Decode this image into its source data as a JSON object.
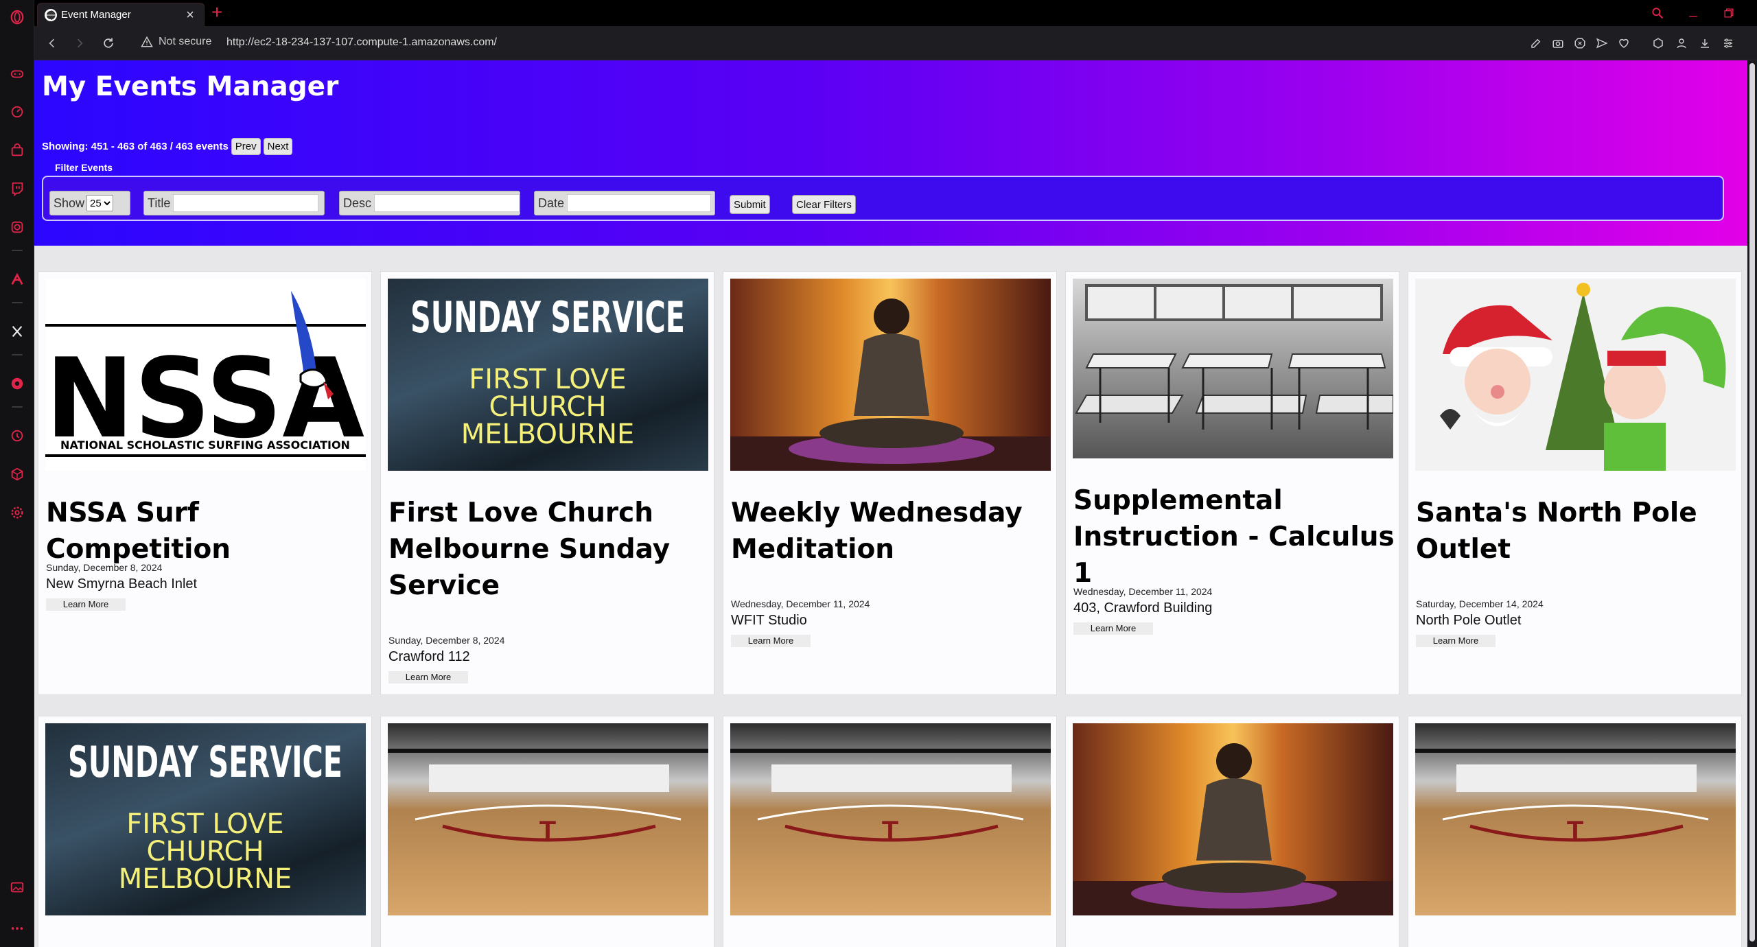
{
  "browser": {
    "tab_title": "Event Manager",
    "new_tab": "+",
    "tab_close": "×",
    "security_label": "Not secure",
    "url": "http://ec2-18-234-137-107.compute-1.amazonaws.com/",
    "accent_color": "#e0244a"
  },
  "sidebar": {
    "icons": [
      "opera-logo-icon",
      "gamepad-icon",
      "speed-dial-icon",
      "shopping-bag-icon",
      "twitch-icon",
      "snapshot-icon",
      "arc-icon",
      "x-twitter-icon",
      "record-icon",
      "history-icon",
      "box-icon",
      "settings-icon",
      "photo-icon",
      "more-icon"
    ]
  },
  "header": {
    "title": "My Events Manager",
    "showing_text": "Showing: 451 - 463 of 463 / 463 events",
    "prev_label": "Prev",
    "next_label": "Next",
    "gradient_colors": [
      "#2b06ff",
      "#e200e8"
    ]
  },
  "filters": {
    "legend": "Filter Events",
    "show_label": "Show",
    "show_value": "25",
    "title_label": "Title",
    "desc_label": "Desc",
    "date_label": "Date",
    "submit_label": "Submit",
    "clear_label": "Clear Filters"
  },
  "events": [
    {
      "title": "NSSA Surf Competition",
      "date": "Sunday, December 8, 2024",
      "location": "New Smyrna Beach Inlet",
      "learn_more": "Learn More",
      "image": "nssa-logo-image",
      "logo_text": "NSSA",
      "logo_subtext": "NATIONAL SCHOLASTIC SURFING ASSOCIATION"
    },
    {
      "title": "First Love Church Melbourne Sunday Service",
      "date": "Sunday, December 8, 2024",
      "location": "Crawford 112",
      "learn_more": "Learn More",
      "image": "sunday-service-image",
      "banner_line1": "SUNDAY SERVICE",
      "banner_line2": "FIRST LOVE",
      "banner_line3": "CHURCH",
      "banner_line4": "MELBOURNE"
    },
    {
      "title": "Weekly Wednesday Meditation",
      "date": "Wednesday, December 11, 2024",
      "location": "WFIT Studio",
      "learn_more": "Learn More",
      "image": "meditation-image"
    },
    {
      "title": "Supplemental Instruction - Calculus 1",
      "date": "Wednesday, December 11, 2024",
      "location": "403, Crawford Building",
      "learn_more": "Learn More",
      "image": "classroom-image"
    },
    {
      "title": "Santa's North Pole Outlet",
      "date": "Saturday, December 14, 2024",
      "location": "North Pole Outlet",
      "learn_more": "Learn More",
      "image": "santa-elf-image"
    }
  ],
  "second_row": [
    {
      "image": "sunday-service-image",
      "banner_line1": "SUNDAY SERVICE",
      "banner_line2": "FIRST LOVE",
      "banner_line3": "CHURCH",
      "banner_line4": "MELBOURNE"
    },
    {
      "image": "gym-court-image"
    },
    {
      "image": "gym-court-image"
    },
    {
      "image": "meditation-image"
    },
    {
      "image": "gym-court-image"
    }
  ]
}
